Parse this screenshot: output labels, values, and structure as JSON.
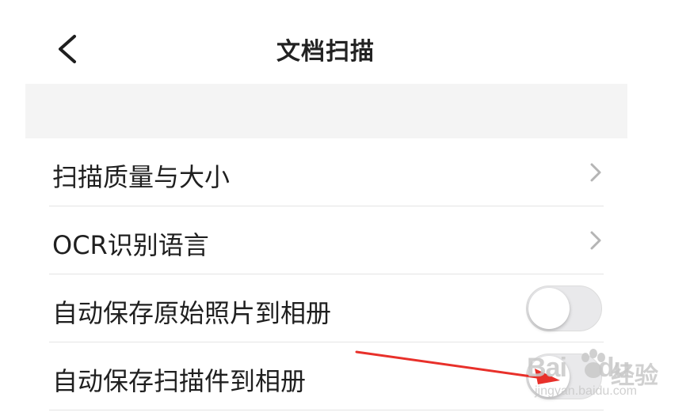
{
  "header": {
    "title": "文档扫描",
    "back_icon": "chevron-left-icon"
  },
  "settings": [
    {
      "label": "扫描质量与大小",
      "control": "chevron"
    },
    {
      "label": "OCR识别语言",
      "control": "chevron"
    },
    {
      "label": "自动保存原始照片到相册",
      "control": "toggle",
      "on": false
    },
    {
      "label": "自动保存扫描件到相册",
      "control": "toggle",
      "on": false
    }
  ],
  "annotation": {
    "color": "#e8302a",
    "icon": "red-arrow"
  },
  "watermark": {
    "brand": "Bai",
    "brand_tail": "du",
    "suffix": "经验",
    "url": "jingyan.baidu.com"
  }
}
